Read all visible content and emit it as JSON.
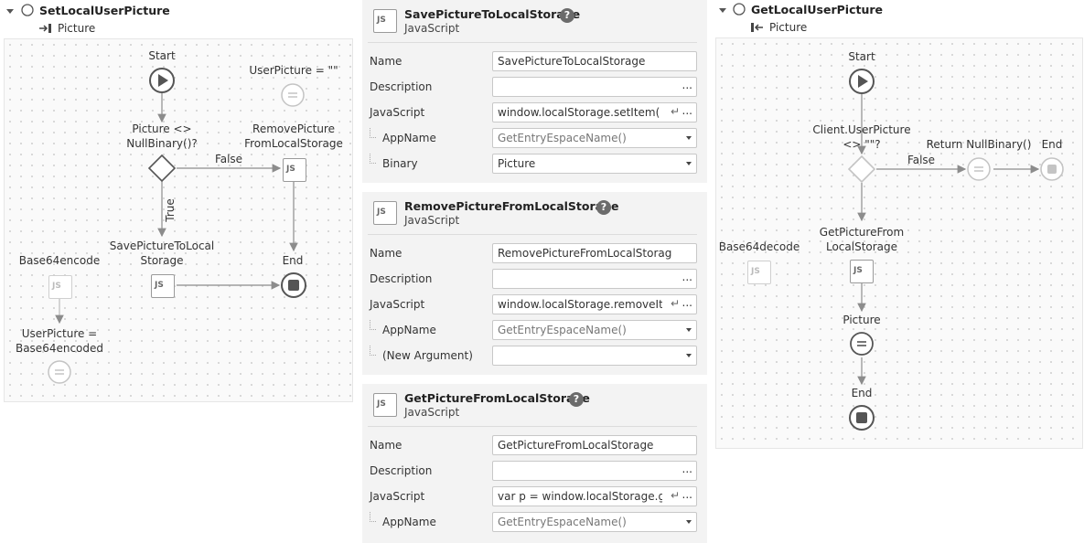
{
  "left": {
    "title": "SetLocalUserPicture",
    "param": "Picture",
    "nodes": {
      "start": "Start",
      "assign_empty": "UserPicture = \"\"",
      "if": "Picture <>\nNullBinary()?",
      "remove": "RemovePicture\nFromLocalStorage",
      "false": "False",
      "true": "True",
      "save": "SavePictureToLocal\nStorage",
      "end": "End",
      "base64": "Base64encode",
      "assign_b64": "UserPicture =\nBase64encoded"
    }
  },
  "panels": [
    {
      "title": "SavePictureToLocalStorage",
      "subtitle": "JavaScript",
      "rows": [
        {
          "label": "Name",
          "value": "SavePictureToLocalStorage",
          "kind": "text"
        },
        {
          "label": "Description",
          "value": "",
          "kind": "dots"
        },
        {
          "label": "JavaScript",
          "value": "window.localStorage.setItem(",
          "kind": "js"
        },
        {
          "label": "AppName",
          "value": "GetEntryEspaceName()",
          "kind": "select",
          "indent": true
        },
        {
          "label": "Binary",
          "value": "Picture",
          "kind": "select",
          "indent": true
        }
      ]
    },
    {
      "title": "RemovePictureFromLocalStorage",
      "subtitle": "JavaScript",
      "rows": [
        {
          "label": "Name",
          "value": "RemovePictureFromLocalStorage",
          "kind": "text"
        },
        {
          "label": "Description",
          "value": "",
          "kind": "dots"
        },
        {
          "label": "JavaScript",
          "value": "window.localStorage.removeIten",
          "kind": "js"
        },
        {
          "label": "AppName",
          "value": "GetEntryEspaceName()",
          "kind": "select",
          "indent": true
        },
        {
          "label": "(New Argument)",
          "value": "",
          "kind": "select",
          "indent": true
        }
      ]
    },
    {
      "title": "GetPictureFromLocalStorage",
      "subtitle": "JavaScript",
      "rows": [
        {
          "label": "Name",
          "value": "GetPictureFromLocalStorage",
          "kind": "text"
        },
        {
          "label": "Description",
          "value": "",
          "kind": "dots"
        },
        {
          "label": "JavaScript",
          "value": "var p = window.localStorage.getI",
          "kind": "js"
        },
        {
          "label": "AppName",
          "value": "GetEntryEspaceName()",
          "kind": "select",
          "indent": true
        }
      ]
    }
  ],
  "right": {
    "title": "GetLocalUserPicture",
    "param": "Picture",
    "nodes": {
      "start": "Start",
      "if": "Client.UserPicture\n<> \"\"?",
      "false": "False",
      "return": "Return NullBinary()",
      "end1": "End",
      "get": "GetPictureFrom\nLocalStorage",
      "base64": "Base64decode",
      "assign": "Picture",
      "end2": "End"
    }
  },
  "icons": {
    "js": "js-icon",
    "help": "help-icon",
    "start": "start-icon",
    "end": "end-icon",
    "assign": "assign-icon",
    "if": "if-diamond-icon"
  },
  "colors": {
    "node_stroke": "#555555",
    "disabled": "#bdbdbd",
    "panel_bg": "#f3f3f3"
  },
  "glyphs": {
    "help": "?",
    "js": "JS",
    "dots": "...",
    "ret": "↵"
  }
}
